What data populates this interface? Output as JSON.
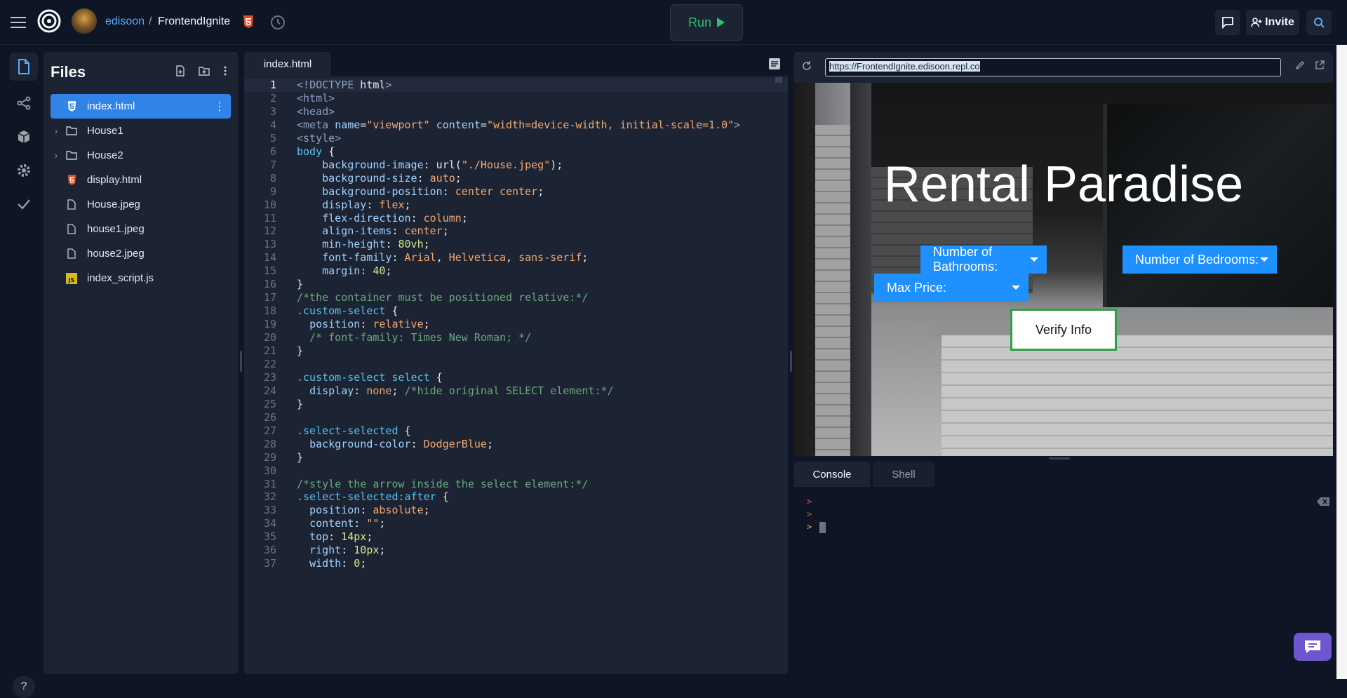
{
  "header": {
    "user": "edisoon",
    "separator": "/",
    "repl_name": "FrontendIgnite",
    "run_label": "Run",
    "invite_label": "Invite"
  },
  "files": {
    "title": "Files",
    "items": [
      {
        "name": "index.html",
        "type": "html",
        "selected": true
      },
      {
        "name": "House1",
        "type": "folder"
      },
      {
        "name": "House2",
        "type": "folder"
      },
      {
        "name": "display.html",
        "type": "html"
      },
      {
        "name": "House.jpeg",
        "type": "file"
      },
      {
        "name": "house1.jpeg",
        "type": "file"
      },
      {
        "name": "house2.jpeg",
        "type": "file"
      },
      {
        "name": "index_script.js",
        "type": "js"
      }
    ]
  },
  "editor": {
    "tab": "index.html",
    "lines": [
      "<!DOCTYPE html>",
      "<html>",
      "<head>",
      "<meta name=\"viewport\" content=\"width=device-width, initial-scale=1.0\">",
      "<style>",
      "body {",
      "    background-image: url(\"./House.jpeg\");",
      "    background-size: auto;",
      "    background-position: center center;",
      "    display: flex;",
      "    flex-direction: column;",
      "    align-items: center;",
      "    min-height: 80vh;",
      "    font-family: Arial, Helvetica, sans-serif;",
      "    margin: 40;",
      "}",
      "/*the container must be positioned relative:*/",
      ".custom-select {",
      "  position: relative;",
      "  /* font-family: Times New Roman; */",
      "}",
      "",
      ".custom-select select {",
      "  display: none; /*hide original SELECT element:*/",
      "}",
      "",
      ".select-selected {",
      "  background-color: DodgerBlue;",
      "}",
      "",
      "/*style the arrow inside the select element:*/",
      ".select-selected:after {",
      "  position: absolute;",
      "  content: \"\";",
      "  top: 14px;",
      "  right: 10px;",
      "  width: 0;"
    ]
  },
  "webview": {
    "url": "https://FrontendIgnite.edisoon.repl.co",
    "title": "Rental Paradise",
    "dropdowns": {
      "bathrooms": "Number of Bathrooms:",
      "bedrooms": "Number of Bedrooms:",
      "price": "Max Price:"
    },
    "verify_label": "Verify Info"
  },
  "console": {
    "tabs": [
      "Console",
      "Shell"
    ],
    "prompts": [
      ">",
      ">",
      ">"
    ]
  },
  "help_label": "?",
  "colors": {
    "accent": "#3183e8",
    "run_green": "#2fbf71",
    "dodger_blue": "#1e90ff",
    "verify_border": "#2ea043"
  }
}
